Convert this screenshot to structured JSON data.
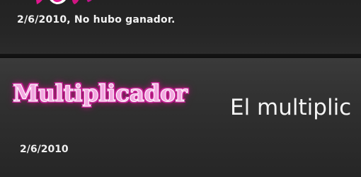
{
  "colors": {
    "background": "#1c1c1c",
    "logo_fill": "#f3a6e0",
    "logo_outline": "#c0148e",
    "text": "#f2f2f2"
  },
  "previous_entry": {
    "logo_icon": "pink-logo-icon",
    "result": "2/6/2010, No hubo ganador."
  },
  "current_entry": {
    "logo_text": "Multiplicador",
    "headline": "El multiplic",
    "date": "2/6/2010"
  }
}
